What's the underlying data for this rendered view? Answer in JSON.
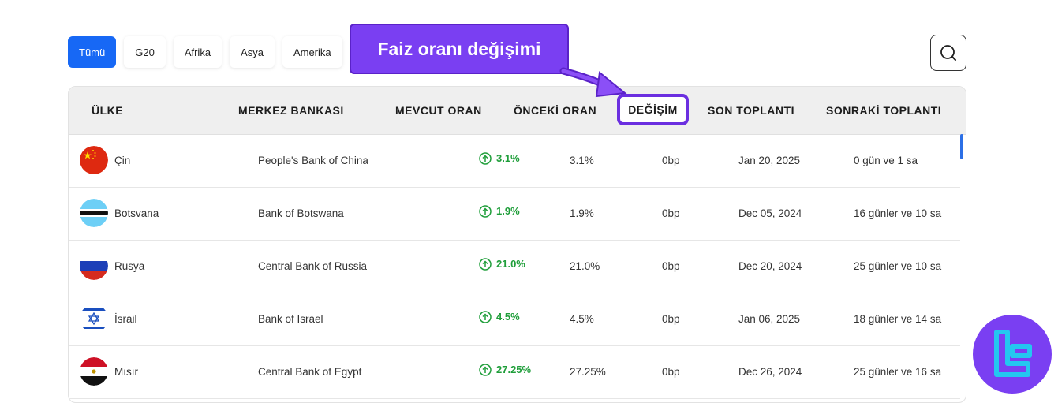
{
  "tabs": [
    {
      "label": "Tümü",
      "active": true
    },
    {
      "label": "G20",
      "active": false
    },
    {
      "label": "Afrika",
      "active": false
    },
    {
      "label": "Asya",
      "active": false
    },
    {
      "label": "Amerika",
      "active": false
    }
  ],
  "callout": {
    "text": "Faiz oranı değişimi"
  },
  "table": {
    "headers": {
      "country": "ÜLKE",
      "bank": "MERKEZ BANKASI",
      "current": "MEVCUT ORAN",
      "previous": "ÖNCEKİ ORAN",
      "change": "DEĞİŞİM",
      "last": "SON TOPLANTI",
      "next": "SONRAKİ TOPLANTI"
    },
    "rows": [
      {
        "country": "Çin",
        "bank": "People's Bank of China",
        "current": "3.1%",
        "previous": "3.1%",
        "change": "0bp",
        "last": "Jan 20, 2025",
        "next": "0 gün ve 1 sa"
      },
      {
        "country": "Botsvana",
        "bank": "Bank of Botswana",
        "current": "1.9%",
        "previous": "1.9%",
        "change": "0bp",
        "last": "Dec 05, 2024",
        "next": "16 günler ve 10 sa"
      },
      {
        "country": "Rusya",
        "bank": "Central Bank of Russia",
        "current": "21.0%",
        "previous": "21.0%",
        "change": "0bp",
        "last": "Dec 20, 2024",
        "next": "25 günler ve 10 sa"
      },
      {
        "country": "İsrail",
        "bank": "Bank of Israel",
        "current": "4.5%",
        "previous": "4.5%",
        "change": "0bp",
        "last": "Jan 06, 2025",
        "next": "18 günler ve 14 sa"
      },
      {
        "country": "Mısır",
        "bank": "Central Bank of Egypt",
        "current": "27.25%",
        "previous": "27.25%",
        "change": "0bp",
        "last": "Dec 26, 2024",
        "next": "25 günler ve 16 sa"
      }
    ]
  },
  "colors": {
    "accent": "#1768f5",
    "callout": "#7a3ff2",
    "positive": "#1f9e3a"
  }
}
